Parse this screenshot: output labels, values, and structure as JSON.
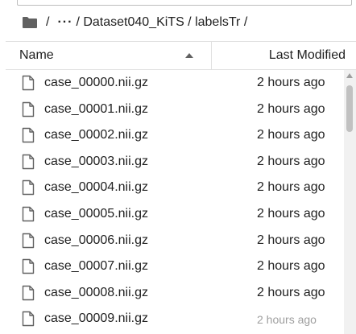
{
  "breadcrumb": {
    "folder_icon": "folder-icon",
    "root_sep": "/",
    "ellipsis": "···",
    "path": "/ Dataset040_KiTS / labelsTr /"
  },
  "header": {
    "name_label": "Name",
    "sort_icon": "caret-up-icon",
    "modified_label": "Last Modified"
  },
  "files": [
    {
      "name": "case_00000.nii.gz",
      "modified": "2 hours ago"
    },
    {
      "name": "case_00001.nii.gz",
      "modified": "2 hours ago"
    },
    {
      "name": "case_00002.nii.gz",
      "modified": "2 hours ago"
    },
    {
      "name": "case_00003.nii.gz",
      "modified": "2 hours ago"
    },
    {
      "name": "case_00004.nii.gz",
      "modified": "2 hours ago"
    },
    {
      "name": "case_00005.nii.gz",
      "modified": "2 hours ago"
    },
    {
      "name": "case_00006.nii.gz",
      "modified": "2 hours ago"
    },
    {
      "name": "case_00007.nii.gz",
      "modified": "2 hours ago"
    },
    {
      "name": "case_00008.nii.gz",
      "modified": "2 hours ago"
    },
    {
      "name": "case_00009.nii.gz",
      "modified": "2 hours ago"
    }
  ],
  "colors": {
    "text": "#212121",
    "border": "#e0e0e0",
    "scroll_track": "#f1f1f1",
    "scroll_thumb": "#c1c1c1"
  }
}
